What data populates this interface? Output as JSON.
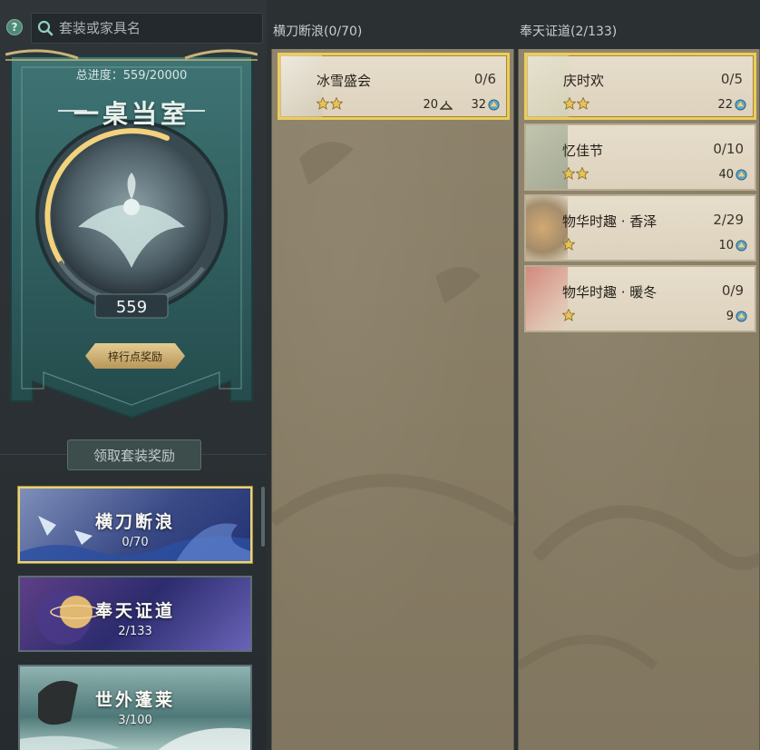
{
  "search": {
    "placeholder": "套装或家具名"
  },
  "help": {
    "label": "?"
  },
  "banner": {
    "progress_label": "总进度：559/20000",
    "title": "一桌当室",
    "score": "559",
    "progress_fraction": 0.028,
    "reward_button": "梓行点奖励"
  },
  "claim_button": "领取套装奖励",
  "sets": [
    {
      "name": "横刀断浪",
      "count": "0/70",
      "active": true,
      "theme": "blue"
    },
    {
      "name": "奉天证道",
      "count": "2/133",
      "active": false,
      "theme": "purple"
    },
    {
      "name": "世外蓬莱",
      "count": "3/100",
      "active": false,
      "theme": "teal"
    }
  ],
  "columns": [
    {
      "header": "横刀断浪(0/70)",
      "items": [
        {
          "name": "冰雪盛会",
          "count": "0/6",
          "stars": 2,
          "points_a": "20",
          "points_b": "32",
          "highlight": true
        }
      ]
    },
    {
      "header": "奉天证道(2/133)",
      "items": [
        {
          "name": "庆时欢",
          "count": "0/5",
          "stars": 2,
          "points_b": "22",
          "highlight": true
        },
        {
          "name": "忆佳节",
          "count": "0/10",
          "stars": 2,
          "points_b": "40",
          "highlight": false
        },
        {
          "name": "物华时趣 · 香泽",
          "count": "2/29",
          "stars": 1,
          "points_b": "10",
          "highlight": false
        },
        {
          "name": "物华时趣 · 暖冬",
          "count": "0/9",
          "stars": 1,
          "points_b": "9",
          "highlight": false
        }
      ]
    }
  ],
  "colors": {
    "gold": "#e8d27a",
    "teal": "#2e5f5e",
    "parchment": "#8a7f67"
  }
}
